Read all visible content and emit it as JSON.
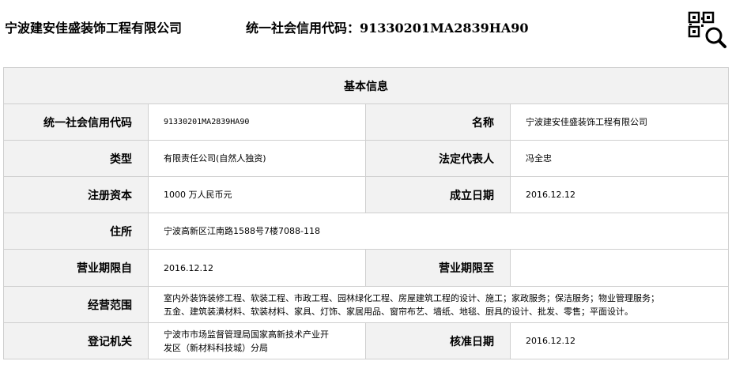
{
  "header": {
    "company_name": "宁波建安佳盛装饰工程有限公司",
    "credit_code_text": "统一社会信用代码：91330201MA2839HA90",
    "qr_search_icon": "qr-code-search-icon"
  },
  "section": {
    "title": "基本信息"
  },
  "rows": {
    "credit_code": {
      "label": "统一社会信用代码",
      "value": "91330201MA2839HA90"
    },
    "name": {
      "label": "名称",
      "value": "宁波建安佳盛装饰工程有限公司"
    },
    "type": {
      "label": "类型",
      "value": "有限责任公司(自然人独资)"
    },
    "legal_rep": {
      "label": "法定代表人",
      "value": "冯全忠"
    },
    "capital": {
      "label": "注册资本",
      "value": "1000 万人民币元"
    },
    "established": {
      "label": "成立日期",
      "value": "2016.12.12"
    },
    "address": {
      "label": "住所",
      "value": "宁波高新区江南路1588号7楼7088-118"
    },
    "term_from": {
      "label": "营业期限自",
      "value": "2016.12.12"
    },
    "term_to": {
      "label": "营业期限至",
      "value": ""
    },
    "scope": {
      "label": "经营范围",
      "line1": "室内外装饰装修工程、软装工程、市政工程、园林绿化工程、房屋建筑工程的设计、施工；家政服务；保洁服务；物业管理服务；",
      "line2": "五金、建筑装潢材料、软装材料、家具、灯饰、家居用品、窗帘布艺、墙纸、地毯、厨具的设计、批发、零售；平面设计。"
    },
    "authority": {
      "label": "登记机关",
      "line1": "宁波市市场监督管理局国家高新技术产业开",
      "line2": "发区（新材料科技城）分局"
    },
    "approved": {
      "label": "核准日期",
      "value": "2016.12.12"
    }
  }
}
